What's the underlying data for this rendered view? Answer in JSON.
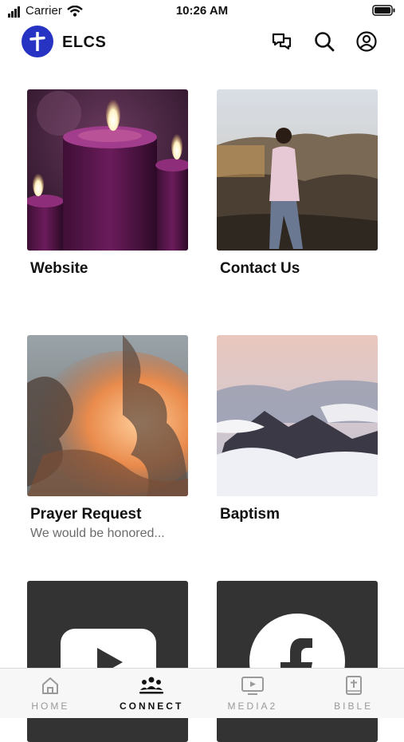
{
  "status_bar": {
    "carrier": "Carrier",
    "time": "10:26 AM"
  },
  "header": {
    "app_name": "ELCS"
  },
  "cards": [
    {
      "title": "Website",
      "subtitle": ""
    },
    {
      "title": "Contact Us",
      "subtitle": ""
    },
    {
      "title": "Prayer Request",
      "subtitle": "We would be honored..."
    },
    {
      "title": "Baptism",
      "subtitle": ""
    },
    {
      "title": "",
      "subtitle": ""
    },
    {
      "title": "",
      "subtitle": ""
    }
  ],
  "tabs": [
    {
      "label": "HOME",
      "icon": "home-icon",
      "active": false
    },
    {
      "label": "CONNECT",
      "icon": "people-icon",
      "active": true
    },
    {
      "label": "MEDIA2",
      "icon": "tv-icon",
      "active": false
    },
    {
      "label": "BIBLE",
      "icon": "bible-icon",
      "active": false
    }
  ],
  "colors": {
    "brand": "#2733c2",
    "active_tab": "#111111",
    "inactive_tab": "#9a9a9a"
  }
}
